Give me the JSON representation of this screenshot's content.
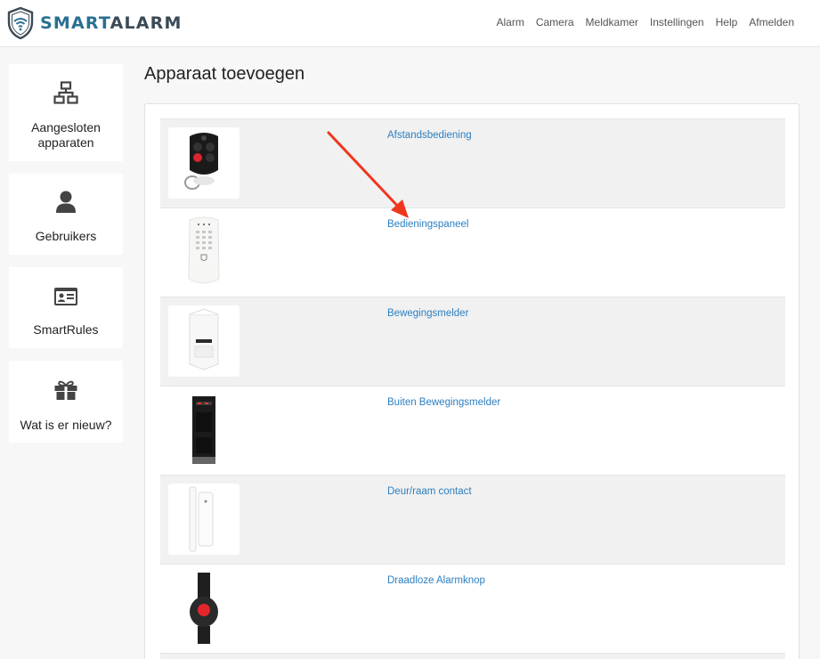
{
  "brand": {
    "part1": "SMART",
    "part2": "ALARM"
  },
  "nav": [
    "Alarm",
    "Camera",
    "Meldkamer",
    "Instellingen",
    "Help",
    "Afmelden"
  ],
  "sidebar": [
    {
      "label": "Aangesloten apparaten",
      "icon": "network-icon"
    },
    {
      "label": "Gebruikers",
      "icon": "user-icon"
    },
    {
      "label": "SmartRules",
      "icon": "id-card-icon"
    },
    {
      "label": "Wat is er nieuw?",
      "icon": "gift-icon"
    }
  ],
  "page_title": "Apparaat toevoegen",
  "devices": [
    {
      "name": "Afstandsbediening",
      "image": "remote-control-image"
    },
    {
      "name": "Bedieningspaneel",
      "image": "keypad-image"
    },
    {
      "name": "Bewegingsmelder",
      "image": "motion-sensor-image"
    },
    {
      "name": "Buiten Bewegingsmelder",
      "image": "outdoor-motion-sensor-image"
    },
    {
      "name": "Deur/raam contact",
      "image": "door-window-contact-image"
    },
    {
      "name": "Draadloze Alarmknop",
      "image": "panic-button-image"
    }
  ],
  "colors": {
    "link": "#2b7fc1",
    "brand": "#2a6f93",
    "annotation_arrow": "#f0361d"
  }
}
